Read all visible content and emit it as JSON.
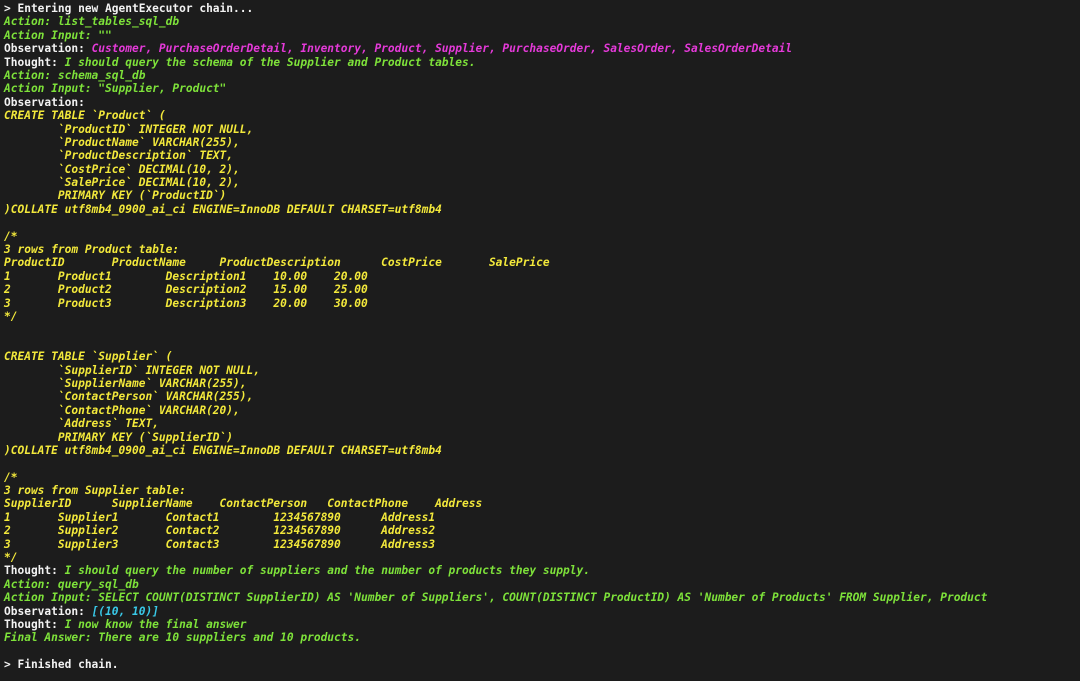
{
  "terminal": {
    "lines": [
      [
        {
          "t": "> Entering new AgentExecutor chain...",
          "c": "w"
        }
      ],
      [
        {
          "t": "Action: list_tables_sql_db",
          "c": "g"
        }
      ],
      [
        {
          "t": "Action Input: \"\"",
          "c": "g"
        }
      ],
      [
        {
          "t": "Observation: ",
          "c": "w"
        },
        {
          "t": "Customer, PurchaseOrderDetail, Inventory, Product, Supplier, PurchaseOrder, SalesOrder, SalesOrderDetail",
          "c": "m"
        }
      ],
      [
        {
          "t": "Thought: ",
          "c": "w"
        },
        {
          "t": "I should query the schema of the Supplier and Product tables.",
          "c": "g"
        }
      ],
      [
        {
          "t": "Action: schema_sql_db",
          "c": "g"
        }
      ],
      [
        {
          "t": "Action Input: \"Supplier, Product\"",
          "c": "g"
        }
      ],
      [
        {
          "t": "Observation:",
          "c": "w"
        }
      ],
      [
        {
          "t": "CREATE TABLE `Product` (",
          "c": "y"
        }
      ],
      [
        {
          "t": "        `ProductID` INTEGER NOT NULL,",
          "c": "y"
        }
      ],
      [
        {
          "t": "        `ProductName` VARCHAR(255),",
          "c": "y"
        }
      ],
      [
        {
          "t": "        `ProductDescription` TEXT,",
          "c": "y"
        }
      ],
      [
        {
          "t": "        `CostPrice` DECIMAL(10, 2),",
          "c": "y"
        }
      ],
      [
        {
          "t": "        `SalePrice` DECIMAL(10, 2),",
          "c": "y"
        }
      ],
      [
        {
          "t": "        PRIMARY KEY (`ProductID`)",
          "c": "y"
        }
      ],
      [
        {
          "t": ")COLLATE utf8mb4_0900_ai_ci ENGINE=InnoDB DEFAULT CHARSET=utf8mb4",
          "c": "y"
        }
      ],
      [
        {
          "t": "",
          "c": "y"
        }
      ],
      [
        {
          "t": "/*",
          "c": "y"
        }
      ],
      [
        {
          "t": "3 rows from Product table:",
          "c": "y"
        }
      ],
      [
        {
          "t": "ProductID       ProductName     ProductDescription      CostPrice       SalePrice",
          "c": "y"
        }
      ],
      [
        {
          "t": "1       Product1        Description1    10.00    20.00",
          "c": "y"
        }
      ],
      [
        {
          "t": "2       Product2        Description2    15.00    25.00",
          "c": "y"
        }
      ],
      [
        {
          "t": "3       Product3        Description3    20.00    30.00",
          "c": "y"
        }
      ],
      [
        {
          "t": "*/",
          "c": "y"
        }
      ],
      [
        {
          "t": "",
          "c": "y"
        }
      ],
      [
        {
          "t": "",
          "c": "y"
        }
      ],
      [
        {
          "t": "CREATE TABLE `Supplier` (",
          "c": "y"
        }
      ],
      [
        {
          "t": "        `SupplierID` INTEGER NOT NULL,",
          "c": "y"
        }
      ],
      [
        {
          "t": "        `SupplierName` VARCHAR(255),",
          "c": "y"
        }
      ],
      [
        {
          "t": "        `ContactPerson` VARCHAR(255),",
          "c": "y"
        }
      ],
      [
        {
          "t": "        `ContactPhone` VARCHAR(20),",
          "c": "y"
        }
      ],
      [
        {
          "t": "        `Address` TEXT,",
          "c": "y"
        }
      ],
      [
        {
          "t": "        PRIMARY KEY (`SupplierID`)",
          "c": "y"
        }
      ],
      [
        {
          "t": ")COLLATE utf8mb4_0900_ai_ci ENGINE=InnoDB DEFAULT CHARSET=utf8mb4",
          "c": "y"
        }
      ],
      [
        {
          "t": "",
          "c": "y"
        }
      ],
      [
        {
          "t": "/*",
          "c": "y"
        }
      ],
      [
        {
          "t": "3 rows from Supplier table:",
          "c": "y"
        }
      ],
      [
        {
          "t": "SupplierID      SupplierName    ContactPerson   ContactPhone    Address",
          "c": "y"
        }
      ],
      [
        {
          "t": "1       Supplier1       Contact1        1234567890      Address1",
          "c": "y"
        }
      ],
      [
        {
          "t": "2       Supplier2       Contact2        1234567890      Address2",
          "c": "y"
        }
      ],
      [
        {
          "t": "3       Supplier3       Contact3        1234567890      Address3",
          "c": "y"
        }
      ],
      [
        {
          "t": "*/",
          "c": "y"
        }
      ],
      [
        {
          "t": "Thought: ",
          "c": "w"
        },
        {
          "t": "I should query the number of suppliers and the number of products they supply.",
          "c": "g"
        }
      ],
      [
        {
          "t": "Action: query_sql_db",
          "c": "g"
        }
      ],
      [
        {
          "t": "Action Input: SELECT COUNT(DISTINCT SupplierID) AS 'Number of Suppliers', COUNT(DISTINCT ProductID) AS 'Number of Products' FROM Supplier, Product",
          "c": "g"
        }
      ],
      [
        {
          "t": "Observation: ",
          "c": "w"
        },
        {
          "t": "[(10, 10)]",
          "c": "c"
        }
      ],
      [
        {
          "t": "Thought: ",
          "c": "w"
        },
        {
          "t": "I now know the final answer",
          "c": "g"
        }
      ],
      [
        {
          "t": "Final Answer: There are 10 suppliers and 10 products.",
          "c": "g"
        }
      ],
      [
        {
          "t": "",
          "c": "w"
        }
      ],
      [
        {
          "t": "> Finished chain.",
          "c": "w"
        }
      ]
    ]
  }
}
